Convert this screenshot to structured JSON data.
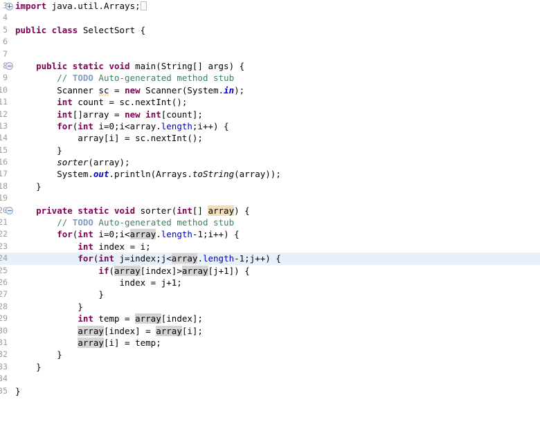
{
  "editor": {
    "language": "Java",
    "class_name": "SelectSort",
    "gutter_first_line": 3,
    "gutter_last_line": 35,
    "current_line_number": 24,
    "colors": {
      "background": "#ffffff",
      "keyword": "#7f0055",
      "comment": "#3f7f5f",
      "todo_tag": "#7f9fbf",
      "field": "#0000c0",
      "line_number": "#9b9b9b",
      "current_line_highlight": "#e7f0fb",
      "write_occurrence": "#f3dfb4",
      "read_occurrence": "#d4d4d4",
      "warning_squiggle": "#e8a33d"
    },
    "lines": [
      {
        "num": "3",
        "fold": "plus",
        "current": false,
        "text": "import java.util.Arrays;"
      },
      {
        "num": "4",
        "fold": null,
        "current": false,
        "text": ""
      },
      {
        "num": "5",
        "fold": null,
        "current": false,
        "text": "public class SelectSort {"
      },
      {
        "num": "6",
        "fold": null,
        "current": false,
        "text": ""
      },
      {
        "num": "7",
        "fold": null,
        "current": false,
        "text": ""
      },
      {
        "num": "8",
        "fold": "minus",
        "current": false,
        "text": "    public static void main(String[] args) {"
      },
      {
        "num": "9",
        "fold": null,
        "current": false,
        "text": "        // TODO Auto-generated method stub"
      },
      {
        "num": "10",
        "fold": null,
        "current": false,
        "text": "        Scanner sc = new Scanner(System.in);"
      },
      {
        "num": "11",
        "fold": null,
        "current": false,
        "text": "        int count = sc.nextInt();"
      },
      {
        "num": "12",
        "fold": null,
        "current": false,
        "text": "        int[]array = new int[count];"
      },
      {
        "num": "13",
        "fold": null,
        "current": false,
        "text": "        for(int i=0;i<array.length;i++) {"
      },
      {
        "num": "14",
        "fold": null,
        "current": false,
        "text": "            array[i] = sc.nextInt();"
      },
      {
        "num": "15",
        "fold": null,
        "current": false,
        "text": "        }"
      },
      {
        "num": "16",
        "fold": null,
        "current": false,
        "text": "        sorter(array);"
      },
      {
        "num": "17",
        "fold": null,
        "current": false,
        "text": "        System.out.println(Arrays.toString(array));"
      },
      {
        "num": "18",
        "fold": null,
        "current": false,
        "text": "    }"
      },
      {
        "num": "19",
        "fold": null,
        "current": false,
        "text": ""
      },
      {
        "num": "20",
        "fold": "minus",
        "current": false,
        "text": "    private static void sorter(int[] array) {"
      },
      {
        "num": "21",
        "fold": null,
        "current": false,
        "text": "        // TODO Auto-generated method stub"
      },
      {
        "num": "22",
        "fold": null,
        "current": false,
        "text": "        for(int i=0;i<array.length-1;i++) {"
      },
      {
        "num": "23",
        "fold": null,
        "current": false,
        "text": "            int index = i;"
      },
      {
        "num": "24",
        "fold": null,
        "current": true,
        "text": "            for(int j=index;j<array.length-1;j++) {"
      },
      {
        "num": "25",
        "fold": null,
        "current": false,
        "text": "                if(array[index]>array[j+1]) {"
      },
      {
        "num": "26",
        "fold": null,
        "current": false,
        "text": "                    index = j+1;"
      },
      {
        "num": "27",
        "fold": null,
        "current": false,
        "text": "                }"
      },
      {
        "num": "28",
        "fold": null,
        "current": false,
        "text": "            }"
      },
      {
        "num": "29",
        "fold": null,
        "current": false,
        "text": "            int temp = array[index];"
      },
      {
        "num": "30",
        "fold": null,
        "current": false,
        "text": "            array[index] = array[i];"
      },
      {
        "num": "31",
        "fold": null,
        "current": false,
        "text": "            array[i] = temp;"
      },
      {
        "num": "32",
        "fold": null,
        "current": false,
        "text": "        }"
      },
      {
        "num": "33",
        "fold": null,
        "current": false,
        "text": "    }"
      },
      {
        "num": "34",
        "fold": null,
        "current": false,
        "text": ""
      },
      {
        "num": "35",
        "fold": null,
        "current": false,
        "text": "}"
      }
    ]
  }
}
